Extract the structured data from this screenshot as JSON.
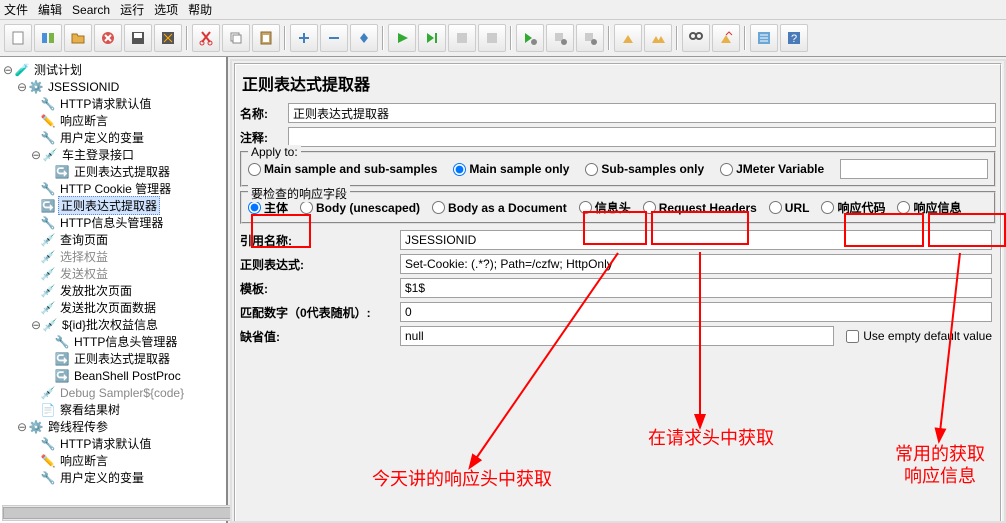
{
  "menu": {
    "file": "文件",
    "edit": "编辑",
    "search": "Search",
    "run": "运行",
    "options": "选项",
    "help": "帮助"
  },
  "tree": {
    "root": "测试计划",
    "n0": "JSESSIONID",
    "n0_0": "HTTP请求默认值",
    "n0_1": "响应断言",
    "n0_2": "用户定义的变量",
    "n0_3": "车主登录接口",
    "n0_3_0": "正则表达式提取器",
    "n0_4": "HTTP Cookie 管理器",
    "n0_5": "正则表达式提取器",
    "n0_6": "HTTP信息头管理器",
    "n0_7": "查询页面",
    "n0_8": "选择权益",
    "n0_9": "发送权益",
    "n0_10": "发放批次页面",
    "n0_11": "发送批次页面数据",
    "n0_12": "${id}批次权益信息",
    "n0_12_0": "HTTP信息头管理器",
    "n0_12_1": "正则表达式提取器",
    "n0_12_2": "BeanShell PostProc",
    "n0_13": "Debug Sampler${code}",
    "n0_14": "察看结果树",
    "n1": "跨线程传参",
    "n1_0": "HTTP请求默认值",
    "n1_1": "响应断言",
    "n1_2": "用户定义的变量"
  },
  "panel": {
    "title": "正则表达式提取器",
    "name_label": "名称:",
    "name_value": "正则表达式提取器",
    "comment_label": "注释:",
    "apply_to_title": "Apply to:",
    "apply_opts": [
      "Main sample and sub-samples",
      "Main sample only",
      "Sub-samples only",
      "JMeter Variable"
    ],
    "field_check_title": "要检查的响应字段",
    "field_opts": [
      "主体",
      "Body (unescaped)",
      "Body as a Document",
      "信息头",
      "Request Headers",
      "URL",
      "响应代码",
      "响应信息"
    ],
    "ref_name_label": "引用名称:",
    "ref_name_value": "JSESSIONID",
    "regex_label": "正则表达式:",
    "regex_value": "Set-Cookie: (.*?); Path=/czfw; HttpOnly",
    "template_label": "模板:",
    "template_value": "$1$",
    "match_label": "匹配数字（0代表随机）:",
    "match_value": "0",
    "default_label": "缺省值:",
    "default_value": "null",
    "use_empty_label": "Use empty default value"
  },
  "annotations": {
    "a1": "今天讲的响应头中获取",
    "a2": "在请求头中获取",
    "a3": "常用的获取\n响应信息"
  }
}
